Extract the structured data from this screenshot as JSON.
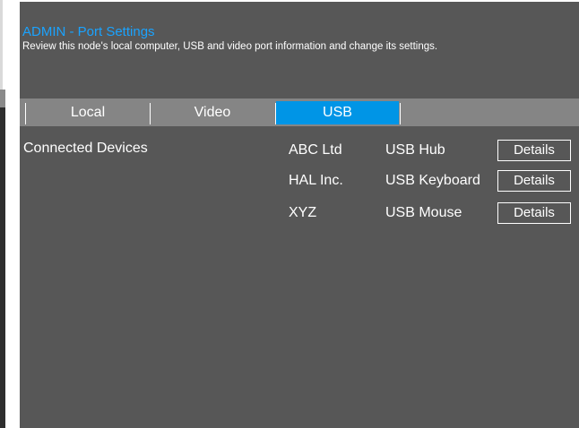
{
  "header": {
    "title": "ADMIN - Port Settings",
    "subtitle": "Review this node's local computer, USB and video port information and change its settings."
  },
  "tabs": [
    {
      "label": "Local",
      "active": false
    },
    {
      "label": "Video",
      "active": false
    },
    {
      "label": "USB",
      "active": true
    }
  ],
  "colors": {
    "accent": "#1aa3ff",
    "active_tab": "#0095e6",
    "panel_bg": "#575757",
    "tab_bar_bg": "#858585"
  },
  "section": {
    "label": "Connected Devices"
  },
  "devices": [
    {
      "vendor": "ABC Ltd",
      "type": "USB Hub",
      "action": "Details"
    },
    {
      "vendor": "HAL Inc.",
      "type": "USB Keyboard",
      "action": "Details"
    },
    {
      "vendor": "XYZ",
      "type": "USB Mouse",
      "action": "Details"
    }
  ]
}
